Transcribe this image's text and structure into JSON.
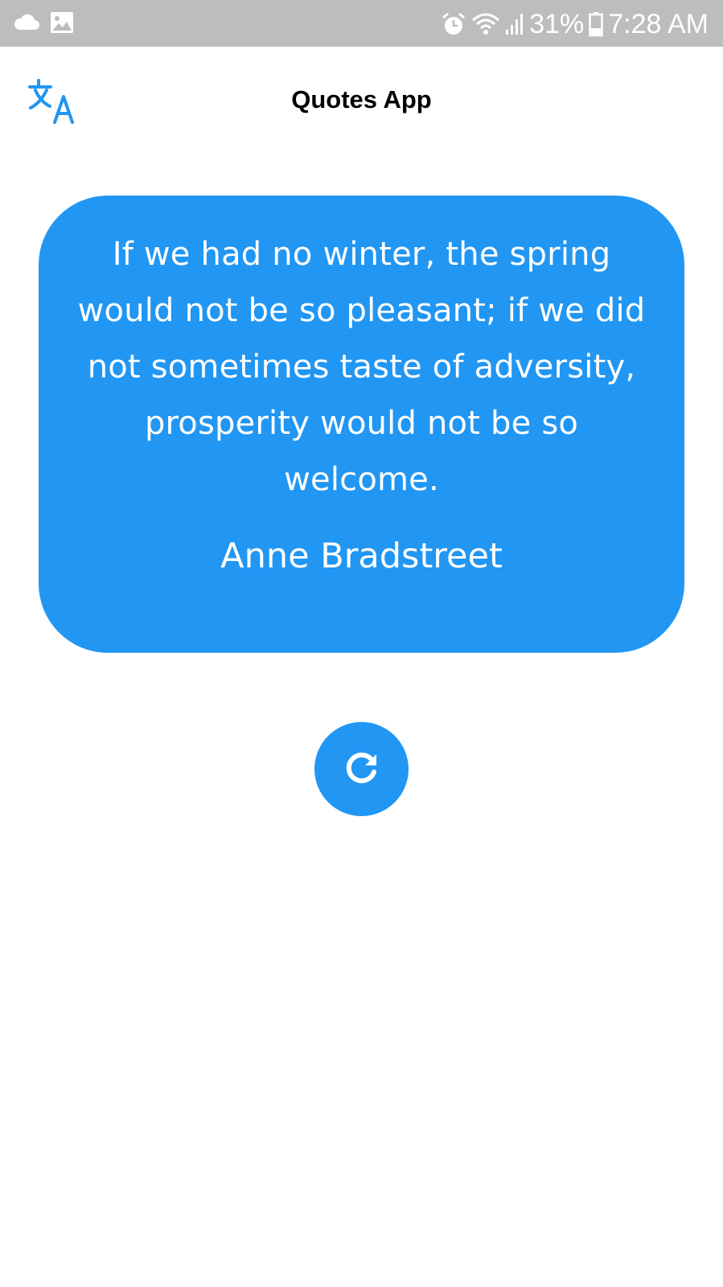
{
  "status_bar": {
    "battery_percent": "31%",
    "time": "7:28 AM",
    "icons": [
      "cloud-icon",
      "image-icon",
      "alarm-icon",
      "wifi-icon",
      "signal-icon",
      "battery-icon"
    ]
  },
  "app_bar": {
    "title": "Quotes App",
    "translate_icon": "translate-icon"
  },
  "quote": {
    "text": "If we had no winter, the spring would not be so pleasant; if we did not sometimes taste of adversity, prosperity would not be so welcome.",
    "author": "Anne Bradstreet"
  },
  "actions": {
    "refresh_icon": "refresh-icon"
  },
  "colors": {
    "accent": "#2196f3",
    "status_bar_bg": "#bdbdbd",
    "background": "#ffffff",
    "title_text": "#000000",
    "quote_text": "#ffffff"
  }
}
